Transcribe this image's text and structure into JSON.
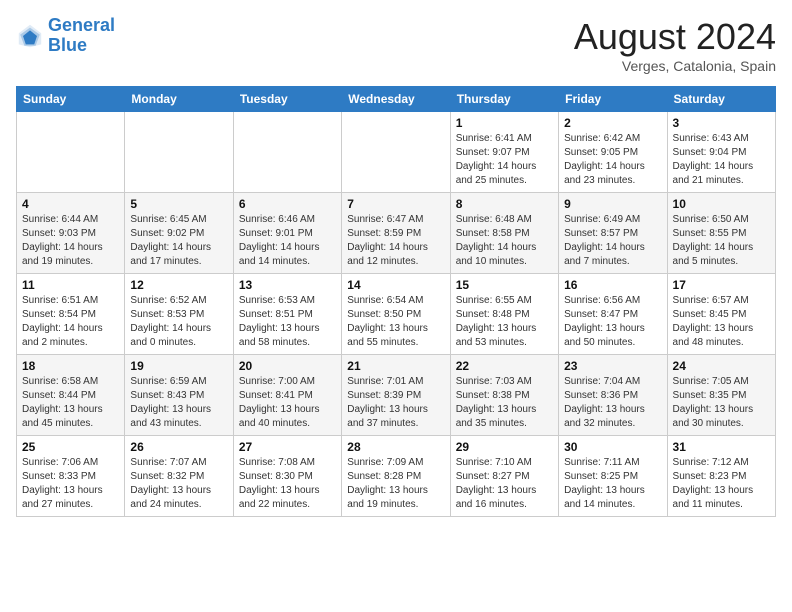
{
  "header": {
    "logo_line1": "General",
    "logo_line2": "Blue",
    "month_year": "August 2024",
    "location": "Verges, Catalonia, Spain"
  },
  "weekdays": [
    "Sunday",
    "Monday",
    "Tuesday",
    "Wednesday",
    "Thursday",
    "Friday",
    "Saturday"
  ],
  "weeks": [
    [
      {
        "day": "",
        "info": ""
      },
      {
        "day": "",
        "info": ""
      },
      {
        "day": "",
        "info": ""
      },
      {
        "day": "",
        "info": ""
      },
      {
        "day": "1",
        "info": "Sunrise: 6:41 AM\nSunset: 9:07 PM\nDaylight: 14 hours\nand 25 minutes."
      },
      {
        "day": "2",
        "info": "Sunrise: 6:42 AM\nSunset: 9:05 PM\nDaylight: 14 hours\nand 23 minutes."
      },
      {
        "day": "3",
        "info": "Sunrise: 6:43 AM\nSunset: 9:04 PM\nDaylight: 14 hours\nand 21 minutes."
      }
    ],
    [
      {
        "day": "4",
        "info": "Sunrise: 6:44 AM\nSunset: 9:03 PM\nDaylight: 14 hours\nand 19 minutes."
      },
      {
        "day": "5",
        "info": "Sunrise: 6:45 AM\nSunset: 9:02 PM\nDaylight: 14 hours\nand 17 minutes."
      },
      {
        "day": "6",
        "info": "Sunrise: 6:46 AM\nSunset: 9:01 PM\nDaylight: 14 hours\nand 14 minutes."
      },
      {
        "day": "7",
        "info": "Sunrise: 6:47 AM\nSunset: 8:59 PM\nDaylight: 14 hours\nand 12 minutes."
      },
      {
        "day": "8",
        "info": "Sunrise: 6:48 AM\nSunset: 8:58 PM\nDaylight: 14 hours\nand 10 minutes."
      },
      {
        "day": "9",
        "info": "Sunrise: 6:49 AM\nSunset: 8:57 PM\nDaylight: 14 hours\nand 7 minutes."
      },
      {
        "day": "10",
        "info": "Sunrise: 6:50 AM\nSunset: 8:55 PM\nDaylight: 14 hours\nand 5 minutes."
      }
    ],
    [
      {
        "day": "11",
        "info": "Sunrise: 6:51 AM\nSunset: 8:54 PM\nDaylight: 14 hours\nand 2 minutes."
      },
      {
        "day": "12",
        "info": "Sunrise: 6:52 AM\nSunset: 8:53 PM\nDaylight: 14 hours\nand 0 minutes."
      },
      {
        "day": "13",
        "info": "Sunrise: 6:53 AM\nSunset: 8:51 PM\nDaylight: 13 hours\nand 58 minutes."
      },
      {
        "day": "14",
        "info": "Sunrise: 6:54 AM\nSunset: 8:50 PM\nDaylight: 13 hours\nand 55 minutes."
      },
      {
        "day": "15",
        "info": "Sunrise: 6:55 AM\nSunset: 8:48 PM\nDaylight: 13 hours\nand 53 minutes."
      },
      {
        "day": "16",
        "info": "Sunrise: 6:56 AM\nSunset: 8:47 PM\nDaylight: 13 hours\nand 50 minutes."
      },
      {
        "day": "17",
        "info": "Sunrise: 6:57 AM\nSunset: 8:45 PM\nDaylight: 13 hours\nand 48 minutes."
      }
    ],
    [
      {
        "day": "18",
        "info": "Sunrise: 6:58 AM\nSunset: 8:44 PM\nDaylight: 13 hours\nand 45 minutes."
      },
      {
        "day": "19",
        "info": "Sunrise: 6:59 AM\nSunset: 8:43 PM\nDaylight: 13 hours\nand 43 minutes."
      },
      {
        "day": "20",
        "info": "Sunrise: 7:00 AM\nSunset: 8:41 PM\nDaylight: 13 hours\nand 40 minutes."
      },
      {
        "day": "21",
        "info": "Sunrise: 7:01 AM\nSunset: 8:39 PM\nDaylight: 13 hours\nand 37 minutes."
      },
      {
        "day": "22",
        "info": "Sunrise: 7:03 AM\nSunset: 8:38 PM\nDaylight: 13 hours\nand 35 minutes."
      },
      {
        "day": "23",
        "info": "Sunrise: 7:04 AM\nSunset: 8:36 PM\nDaylight: 13 hours\nand 32 minutes."
      },
      {
        "day": "24",
        "info": "Sunrise: 7:05 AM\nSunset: 8:35 PM\nDaylight: 13 hours\nand 30 minutes."
      }
    ],
    [
      {
        "day": "25",
        "info": "Sunrise: 7:06 AM\nSunset: 8:33 PM\nDaylight: 13 hours\nand 27 minutes."
      },
      {
        "day": "26",
        "info": "Sunrise: 7:07 AM\nSunset: 8:32 PM\nDaylight: 13 hours\nand 24 minutes."
      },
      {
        "day": "27",
        "info": "Sunrise: 7:08 AM\nSunset: 8:30 PM\nDaylight: 13 hours\nand 22 minutes."
      },
      {
        "day": "28",
        "info": "Sunrise: 7:09 AM\nSunset: 8:28 PM\nDaylight: 13 hours\nand 19 minutes."
      },
      {
        "day": "29",
        "info": "Sunrise: 7:10 AM\nSunset: 8:27 PM\nDaylight: 13 hours\nand 16 minutes."
      },
      {
        "day": "30",
        "info": "Sunrise: 7:11 AM\nSunset: 8:25 PM\nDaylight: 13 hours\nand 14 minutes."
      },
      {
        "day": "31",
        "info": "Sunrise: 7:12 AM\nSunset: 8:23 PM\nDaylight: 13 hours\nand 11 minutes."
      }
    ]
  ]
}
